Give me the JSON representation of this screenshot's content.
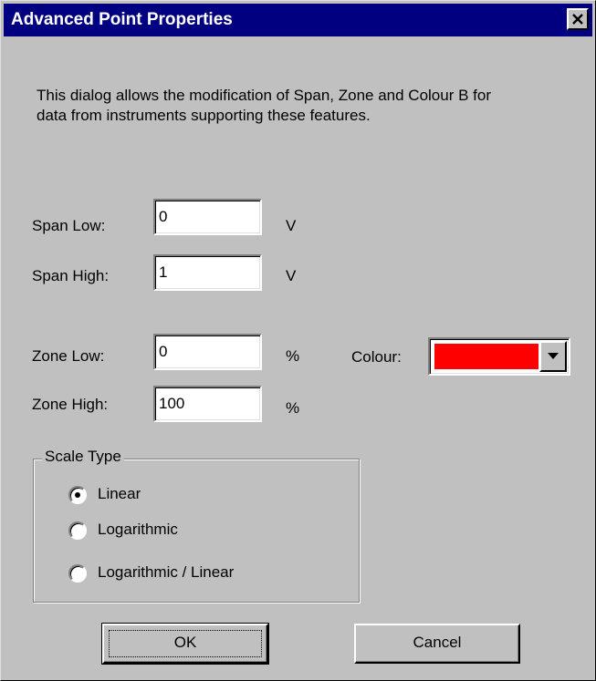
{
  "dialog": {
    "title": "Advanced Point Properties",
    "description": "This dialog allows the modification of Span, Zone and Colour B for data from instruments supporting these features."
  },
  "span": {
    "low_label": "Span Low:",
    "low_value": "0",
    "low_unit": "V",
    "high_label": "Span High:",
    "high_value": "1",
    "high_unit": "V"
  },
  "zone": {
    "low_label": "Zone Low:",
    "low_value": "0",
    "low_unit": "%",
    "high_label": "Zone High:",
    "high_value": "100",
    "high_unit": "%"
  },
  "colour": {
    "label": "Colour:",
    "selected_color": "#ff0000"
  },
  "scale_type": {
    "title": "Scale Type",
    "options": [
      {
        "label": "Linear",
        "selected": true
      },
      {
        "label": "Logarithmic",
        "selected": false
      },
      {
        "label": "Logarithmic / Linear",
        "selected": false
      }
    ]
  },
  "buttons": {
    "ok": "OK",
    "cancel": "Cancel"
  },
  "icons": {
    "close": "close-icon",
    "dropdown": "chevron-down-icon"
  }
}
